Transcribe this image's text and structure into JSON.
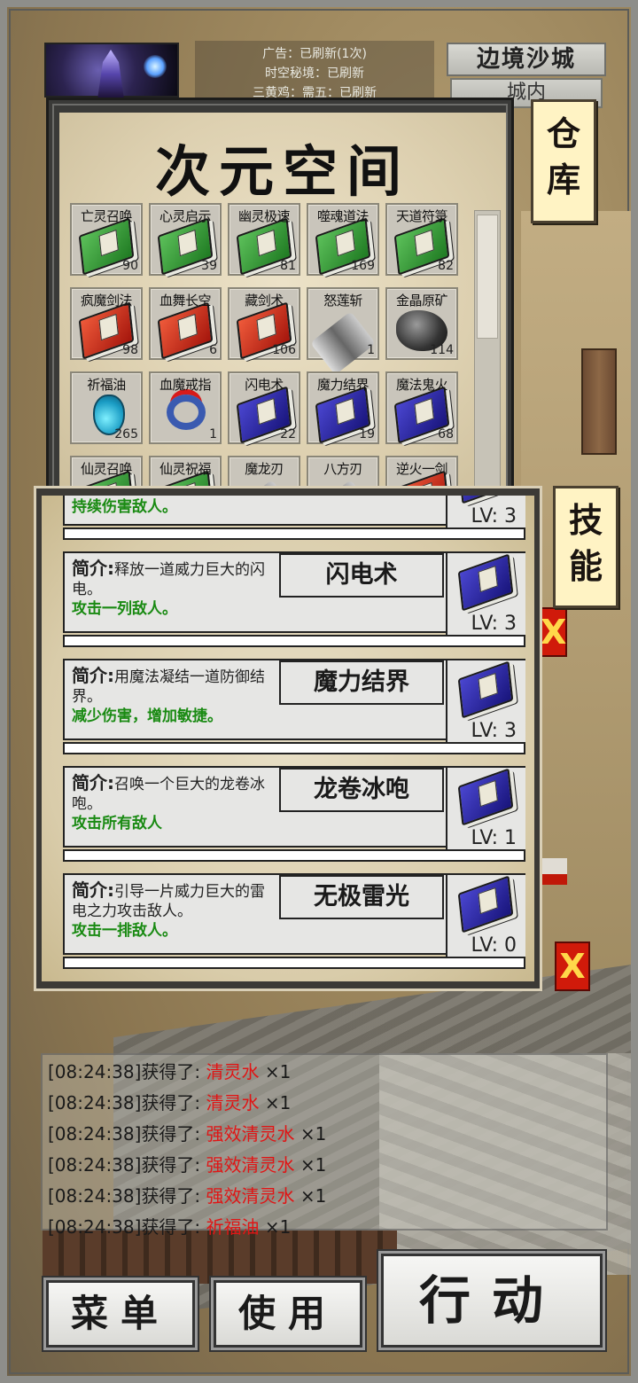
{
  "hud": {
    "notice_lines": [
      "广告：已刷新(1次)",
      "时空秘境：已刷新",
      "三黄鸡：需五：已刷新"
    ],
    "city_name": "边境沙城",
    "city_sub": "城内"
  },
  "side_tabs": {
    "warehouse": "仓库",
    "skill": "技能"
  },
  "close_label": "X",
  "inventory": {
    "title": "次元空间",
    "items": [
      {
        "name": "亡灵召唤",
        "count": "90",
        "icon": "green-book-icon"
      },
      {
        "name": "心灵启示",
        "count": "39",
        "icon": "green-book-icon"
      },
      {
        "name": "幽灵极速",
        "count": "81",
        "icon": "green-book-icon"
      },
      {
        "name": "噬魂道法",
        "count": "169",
        "icon": "green-book-icon"
      },
      {
        "name": "天道符箓",
        "count": "82",
        "icon": "green-book-icon"
      },
      {
        "name": "疯魔剑法",
        "count": "98",
        "icon": "red-book-icon"
      },
      {
        "name": "血舞长空",
        "count": "6",
        "icon": "red-book-icon"
      },
      {
        "name": "藏剑术",
        "count": "106",
        "icon": "red-book-icon"
      },
      {
        "name": "怒莲斩",
        "count": "1",
        "icon": "sword-icon"
      },
      {
        "name": "金晶原矿",
        "count": "114",
        "icon": "ore-icon"
      },
      {
        "name": "祈福油",
        "count": "265",
        "icon": "potion-icon"
      },
      {
        "name": "血魔戒指",
        "count": "1",
        "icon": "ring-icon"
      },
      {
        "name": "闪电术",
        "count": "22",
        "icon": "blue-book-icon"
      },
      {
        "name": "魔力结界",
        "count": "19",
        "icon": "blue-book-icon"
      },
      {
        "name": "魔法鬼火",
        "count": "68",
        "icon": "blue-book-icon"
      },
      {
        "name": "仙灵召唤",
        "count": "",
        "icon": "green-book-icon"
      },
      {
        "name": "仙灵祝福",
        "count": "",
        "icon": "green-book-icon"
      },
      {
        "name": "魔龙刃",
        "count": "",
        "icon": "sword-icon"
      },
      {
        "name": "八方刃",
        "count": "",
        "icon": "sword-icon"
      },
      {
        "name": "逆火一剑",
        "count": "",
        "icon": "red-book-icon"
      }
    ]
  },
  "skills": {
    "intro_label": "简介:",
    "lv_label": "LV:",
    "list": [
      {
        "name": "",
        "desc": "",
        "effect": "持续伤害敌人。",
        "level": "3"
      },
      {
        "name": "闪电术",
        "desc": "释放一道威力巨大的闪电。",
        "effect": "攻击一列敌人。",
        "level": "3"
      },
      {
        "name": "魔力结界",
        "desc": "用魔法凝结一道防御结界。",
        "effect": "减少伤害，增加敏捷。",
        "level": "3"
      },
      {
        "name": "龙卷冰咆",
        "desc": "召唤一个巨大的龙卷冰咆。",
        "effect": "攻击所有敌人",
        "level": "1"
      },
      {
        "name": "无极雷光",
        "desc": "引导一片威力巨大的雷电之力攻击敌人。",
        "effect": "攻击一排敌人。",
        "level": "0"
      }
    ]
  },
  "log": {
    "prefix": "获得了:",
    "lines": [
      {
        "time": "[08:24:38]",
        "item": "清灵水",
        "qty": "×1"
      },
      {
        "time": "[08:24:38]",
        "item": "清灵水",
        "qty": "×1"
      },
      {
        "time": "[08:24:38]",
        "item": "强效清灵水",
        "qty": "×1"
      },
      {
        "time": "[08:24:38]",
        "item": "强效清灵水",
        "qty": "×1"
      },
      {
        "time": "[08:24:38]",
        "item": "强效清灵水",
        "qty": "×1"
      },
      {
        "time": "[08:24:38]",
        "item": "祈福油",
        "qty": "×1"
      }
    ]
  },
  "buttons": {
    "menu": "菜单",
    "use": "使用",
    "action": "行动"
  },
  "colors": {
    "effect_green": "#198a12",
    "log_item_red": "#e01515",
    "tab_bg": "#fff3c4",
    "close_red": "#d01a0a"
  }
}
